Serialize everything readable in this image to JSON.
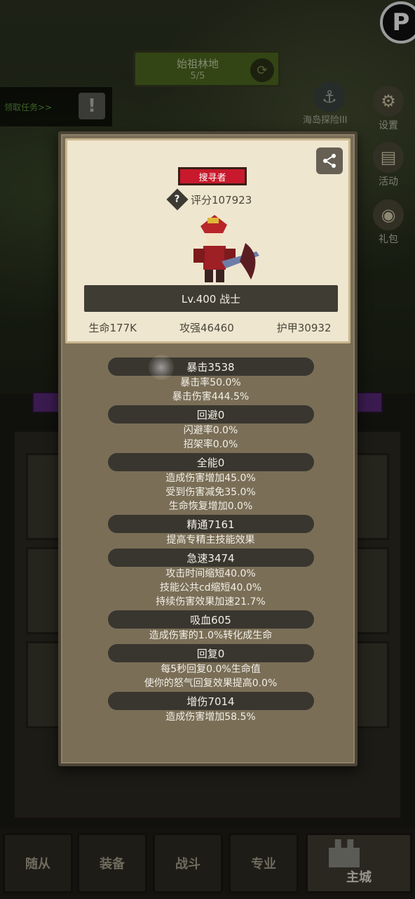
{
  "background": {
    "stage_name": "始祖林地",
    "stage_progress": "5/5",
    "task_label": "领取任务>>",
    "island_label": "海岛探险III",
    "side_buttons": [
      {
        "label": "设置",
        "icon": "gear-icon",
        "glyph": "⚙"
      },
      {
        "label": "活动",
        "icon": "book-icon",
        "glyph": "▤"
      },
      {
        "label": "礼包",
        "icon": "gift-icon",
        "glyph": "◉"
      }
    ],
    "corner_glyph": "P"
  },
  "hero": {
    "class_badge": "搜寻者",
    "score": "评分107923",
    "help_glyph": "?",
    "share_glyph": "⤴",
    "level_text": "Lv.400 战士",
    "stats": [
      "生命177K",
      "攻强46460",
      "护甲30932"
    ]
  },
  "attributes": [
    {
      "header": "暴击3538",
      "lines": [
        "暴击率50.0%",
        "暴击伤害444.5%"
      ]
    },
    {
      "header": "回避0",
      "lines": [
        "闪避率0.0%",
        "招架率0.0%"
      ]
    },
    {
      "header": "全能0",
      "lines": [
        "造成伤害增加45.0%",
        "受到伤害减免35.0%",
        "生命恢复增加0.0%"
      ]
    },
    {
      "header": "精通7161",
      "lines": [
        "提高专精主技能效果"
      ]
    },
    {
      "header": "急速3474",
      "lines": [
        "攻击时间缩短40.0%",
        "技能公共cd缩短40.0%",
        "持续伤害效果加速21.7%"
      ]
    },
    {
      "header": "吸血605",
      "lines": [
        "造成伤害的1.0%转化成生命"
      ]
    },
    {
      "header": "回复0",
      "lines": [
        "每5秒回复0.0%生命值",
        "使你的怒气回复效果提高0.0%"
      ]
    },
    {
      "header": "增伤7014",
      "lines": [
        "造成伤害增加58.5%"
      ]
    }
  ],
  "bottom_nav": {
    "tabs": [
      "随从",
      "装备",
      "战斗",
      "专业",
      "主城"
    ],
    "active": "主城"
  },
  "colors": {
    "badge_red": "#c9192c",
    "modal_bg": "#7a6e57",
    "card_bg": "#efe6cf",
    "pill_bg": "#39362f"
  }
}
